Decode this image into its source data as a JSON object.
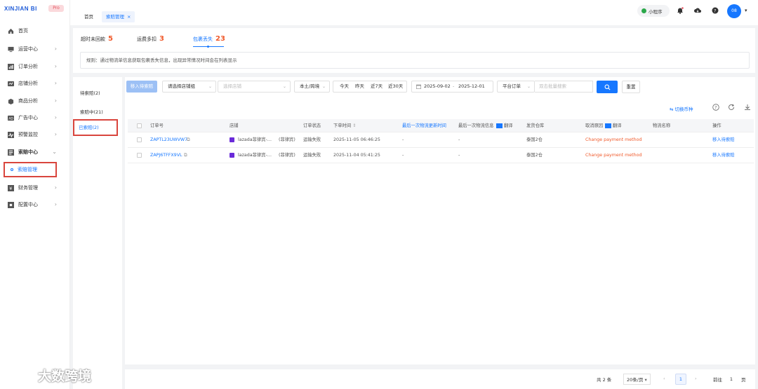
{
  "brand": {
    "logo": "XINJIAN BI",
    "badge": "Pro"
  },
  "sidebar": {
    "items": [
      {
        "label": "首页",
        "icon": "home-icon",
        "chevron": false
      },
      {
        "label": "运营中心",
        "icon": "monitor-icon",
        "chevron": true
      },
      {
        "label": "订单分析",
        "icon": "chart-icon",
        "chevron": true
      },
      {
        "label": "店铺分析",
        "icon": "store-icon",
        "chevron": true
      },
      {
        "label": "商品分析",
        "icon": "product-icon",
        "chevron": true
      },
      {
        "label": "广告中心",
        "icon": "ad-icon",
        "chevron": true
      },
      {
        "label": "预警监控",
        "icon": "alert-icon",
        "chevron": true
      },
      {
        "label": "索赔中心",
        "icon": "claim-icon",
        "chevron": true,
        "expanded": true
      },
      {
        "label": "财务管理",
        "icon": "finance-icon",
        "chevron": true
      },
      {
        "label": "配置中心",
        "icon": "config-icon",
        "chevron": true
      }
    ],
    "sub_active": "索赔管理"
  },
  "tabs": {
    "home": "首页",
    "current": "索赔管理",
    "close": "×"
  },
  "header": {
    "mini_program": "小程序",
    "avatar": "08"
  },
  "stats": [
    {
      "label": "超时未回款",
      "count": "5"
    },
    {
      "label": "运费多扣",
      "count": "3"
    },
    {
      "label": "包裹丢失",
      "count": "23",
      "active": true
    }
  ],
  "rule_text": "规则：通过物流单信息获取包裹丢失信息，出现异常情况时间会在列表显示",
  "left_panel": {
    "pending": "待索赔(2)",
    "claiming": "索赔中(21)",
    "claimed": "已索赔(2)"
  },
  "toolbar": {
    "move_pending": "移入待索赔",
    "shop_group_placeholder": "请选择店铺组",
    "shop_placeholder": "选择店铺",
    "region": "本土/跨境",
    "quick_dates": [
      "今天",
      "昨天",
      "近7天",
      "近30天"
    ],
    "date_start": "2025-09-02",
    "date_sep": "-",
    "date_end": "2025-12-01",
    "order_type": "平台订单",
    "search_placeholder": "双击批量搜索",
    "reset": "重置",
    "switch_currency": "切换币种"
  },
  "table": {
    "headers": {
      "order_no": "订单号",
      "shop": "店铺",
      "status": "订单状态",
      "order_time": "下单时间",
      "last_update": "最后一次物流更新时间",
      "last_info": "最后一次物流信息",
      "translate": "翻译",
      "warehouse": "发货仓库",
      "cancel_reason": "取消原因",
      "cancel_translate": "翻译",
      "logistics_name": "物流名称",
      "action": "操作"
    },
    "rows": [
      {
        "order_no": "ZAPTL23UWVW7",
        "shop": "lazada菲律宾-…",
        "country": "(菲律宾)",
        "status": "运输失败",
        "order_time": "2025-11-05 06:46:25",
        "last_update": "-",
        "last_info": "-",
        "warehouse": "泰国2仓",
        "cancel_reason": "Change payment method",
        "action": "移入待索赔"
      },
      {
        "order_no": "ZAPJ6TFFX9VL",
        "shop": "lazada菲律宾-…",
        "country": "(菲律宾)",
        "status": "运输失败",
        "order_time": "2025-11-04 05:41:25",
        "last_update": "-",
        "last_info": "-",
        "warehouse": "泰国2仓",
        "cancel_reason": "Change payment method",
        "action": "移入待索赔"
      }
    ]
  },
  "pagination": {
    "total": "共 2 条",
    "page_size": "20条/页",
    "prev": "‹",
    "current": "1",
    "next": "›",
    "goto": "前往",
    "goto_value": "1",
    "page_unit": "页"
  },
  "watermark": "大数跨境",
  "colors": {
    "primary": "#1677ff",
    "accent": "#f05a2b",
    "highlight_box": "#d9453d"
  }
}
